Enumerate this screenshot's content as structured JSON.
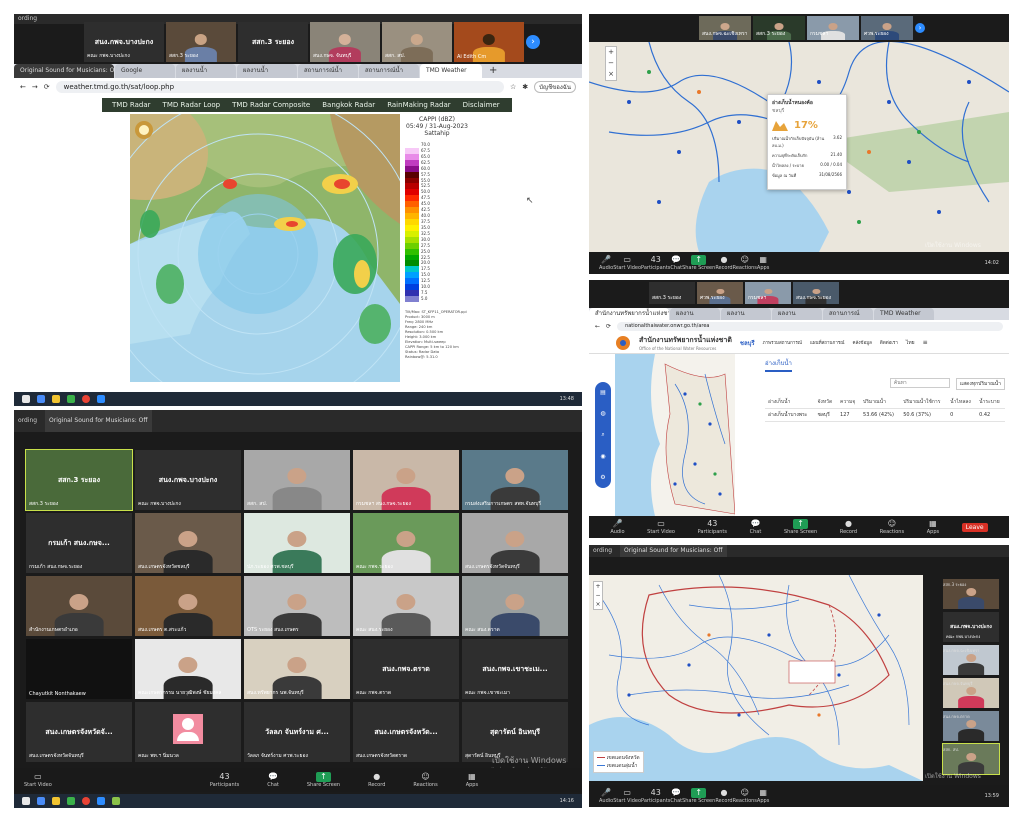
{
  "common": {
    "recording": "ording",
    "original_sound": "Original Sound for Musicians: Off",
    "participants_count": "43",
    "watermark_line1": "เปิดใช้งาน Windows",
    "watermark_line2": "ไปที่ การตั้งค่า เพื่อเปิดใช้งาน Windows",
    "controls": {
      "audio": "Audio",
      "video": "Start Video",
      "participants": "Participants",
      "chat": "Chat",
      "share": "Share Screen",
      "record": "Record",
      "reactions": "Reactions",
      "apps": "Apps",
      "leave": "Leave"
    }
  },
  "panel1": {
    "tiles": [
      {
        "name": "สนง.กพจ.บางปะกง",
        "label": "คณะ กพจ.บางปะกง"
      },
      {
        "name": "",
        "label": "สสก.3 ระยอง"
      },
      {
        "name": "สสก.3 ระยอง",
        "label": ""
      },
      {
        "name": "",
        "label": "สนง.กษจ. จันทบุรี"
      },
      {
        "name": "",
        "label": "สสก. สป."
      },
      {
        "name": "",
        "label": "Ai Edith Cm"
      }
    ],
    "tabs": [
      "Original Sound for Musicians: Off",
      "Google",
      "ผลงานน้ำ",
      "ผลงานน้ำ",
      "สถานการณ์น้ำ",
      "สถานการณ์น้ำ",
      "TMD Weather"
    ],
    "url": "weather.tmd.go.th/sat/loop.php",
    "profile": "บัญชีของฉัน",
    "nav": [
      "TMD Radar",
      "TMD Radar Loop",
      "TMD Radar Composite",
      "Bangkok Radar",
      "RainMaking Radar",
      "Disclaimer"
    ],
    "radar_title": "CAPPI (dBZ)",
    "radar_time": "05:49 / 31-Aug-2023",
    "radar_site": "Sattahip",
    "radar_info": [
      "Tilt/Max: ST_KFP11_OPERATOR.ppi",
      "Product: 3000 m",
      "Freq: 2800 MHz",
      "Range: 240 km",
      "Resolution: 0.500 km",
      "Height: 3.000 km",
      "Elevation: Multi-sweep",
      "CAPPI Range: 5 km to 120 km",
      "Status: Radar Data",
      "Rainbow@: 5.31.0"
    ],
    "legend_labels": [
      "70.0",
      "67.5",
      "65.0",
      "62.5",
      "60.0",
      "57.5",
      "55.0",
      "52.5",
      "50.0",
      "47.5",
      "45.0",
      "42.5",
      "40.0",
      "37.5",
      "35.0",
      "32.5",
      "30.0",
      "27.5",
      "25.0",
      "22.5",
      "20.0",
      "17.5",
      "15.0",
      "12.5",
      "10.0",
      "7.5",
      "5.0"
    ],
    "clock": "13:48"
  },
  "panel2": {
    "tiles": [
      {
        "label": "สนง.กษจ.ฉะเชิงเทรา"
      },
      {
        "label": "สสก.3 ระยอง"
      },
      {
        "label": "กรมชลฯ"
      },
      {
        "label": "ศวพ.ระยอง"
      }
    ],
    "card": {
      "title": "อ่างเก็บน้ำหนองค้อ",
      "subtitle": "ชลบุรี",
      "percent": "17%",
      "rows": [
        {
          "k": "ปริมาณน้ำกักเก็บปัจจุบัน (ล้าน ลบ.ม.)",
          "v": "3.62"
        },
        {
          "k": "ความจุที่ระดับเก็บกัก",
          "v": "21.40"
        },
        {
          "k": "น้ำไหลลง / ระบาย",
          "v": "0.00 / 0.04"
        },
        {
          "k": "ข้อมูล ณ วันที่",
          "v": "31/08/2566"
        }
      ]
    },
    "clock": "14:02"
  },
  "panel3": {
    "tiles": [
      {
        "label": "สสก.3 ระยอง"
      },
      {
        "label": "ศวพ.ระยอง"
      },
      {
        "label": "กรมชลฯ"
      },
      {
        "label": "สนง.กษจ.ระยอง"
      }
    ],
    "url": "nationalthaiwater.onwr.go.th/area",
    "tabs": [
      "สำนักงานทรัพยากรน้ำแห่งชาติ",
      "ผลงาน",
      "ผลงาน",
      "ผลงาน",
      "สถานการณ์",
      "TMD Weather"
    ],
    "org_name": "สำนักงานทรัพยากรน้ำแห่งชาติ",
    "org_sub": "Office of the National Water Resources",
    "province": "ชลบุรี",
    "menu": [
      "ภาพรวมสถานการณ์",
      "แผนที่สถานการณ์",
      "คลังข้อมูล",
      "ติดต่อเรา"
    ],
    "lang": "ไทย",
    "tab_label": "อ่างเก็บน้ำ",
    "search_placeholder": "ค้นหา",
    "filter": "แสดงทุกปริมาณน้ำ",
    "headers": [
      "อ่างเก็บน้ำ",
      "จังหวัด",
      "ความจุ",
      "ปริมาณน้ำ",
      "ปริมาณน้ำใช้การ",
      "น้ำไหลลง",
      "น้ำระบาย"
    ],
    "row": [
      "อ่างเก็บน้ำบางพระ",
      "ชลบุรี",
      "127",
      "53.66 (42%)",
      "50.6 (37%)",
      "0",
      "0.42"
    ],
    "clock": "13:54"
  },
  "panel4": {
    "tiles": [
      {
        "name": "สสก.3 ระยอง",
        "label": "สสก.3 ระยอง"
      },
      {
        "name": "สนง.กพจ.บางปะกง",
        "label": "คณะ กพจ.บางปะกง"
      },
      {
        "name": "",
        "label": "สสก. สป."
      },
      {
        "name": "",
        "label": "กรมชลฯ สนง.กษจ.ระยอง"
      },
      {
        "name": "",
        "label": "กรมส่งเสริมการเกษตร สพท.จันทบุรี"
      },
      {
        "name": "กรมเก้า สนง.กษจ...",
        "label": "กรมเก้า สนง.กษจ.ระยอง"
      },
      {
        "name": "",
        "label": "สนง.เกษตรจังหวัดชลบุรี"
      },
      {
        "name": "",
        "label": "ปภ.ระยอง ศวพ.ชลบุรี"
      },
      {
        "name": "",
        "label": "คณะ กพจ.ระยอง"
      },
      {
        "name": "",
        "label": "สนง.เกษตรจังหวัดจันทบุรี"
      },
      {
        "name": "",
        "label": "สำนักงานเกษตรอำเภอ"
      },
      {
        "name": "",
        "label": "สนง.เกษตร ต.สระแก้ว"
      },
      {
        "name": "",
        "label": "OTS ระยอง สนง.เกษตร"
      },
      {
        "name": "",
        "label": "คณะ สนง.ระยอง"
      },
      {
        "name": "",
        "label": "คณะ สนง.ตราด"
      },
      {
        "name": "",
        "label": "Chayutkit Nonthakaew"
      },
      {
        "name": "",
        "label": "คณะเกษตรกรรม นายวุฒิพงษ์ ชัยมงคล"
      },
      {
        "name": "",
        "label": "สนง.ทรัพยากร นพ.จันทบุรี"
      },
      {
        "name": "สนง.กพจ.ตราด",
        "label": "คณะ กพจ.ตราด"
      },
      {
        "name": "สนง.กพจ.เขาชะเม...",
        "label": "คณะ กพจ.เขาชะเมา"
      },
      {
        "name": "สนง.เกษตรจังหวัดจั...",
        "label": "สนง.เกษตรจังหวัดจันทบุรี"
      },
      {
        "name": "",
        "label": "คณะ พท.ฯ นิ่มนวล"
      },
      {
        "name": "วัลลภ จันทร์งาม ศ...",
        "label": "วัลลภ จันทร์งาม ศวพ.ระยอง"
      },
      {
        "name": "สนง.เกษตรจังหวัด...",
        "label": "สนง.เกษตรจังหวัดตราด"
      },
      {
        "name": "สุดารัตน์ อินทบุรี",
        "label": "สุดารัตน์ อินทบุรี"
      }
    ],
    "clock": "14:16"
  },
  "panel5": {
    "tiles": [
      {
        "name": "",
        "label": "สสก.3 ระยอง"
      },
      {
        "name": "สนง.กพจ.บางปะกง",
        "label": "คณะ กพจ.บางปะกง"
      },
      {
        "name": "",
        "label": "สนง.กษจ.ฉะเชิงเทรา"
      },
      {
        "name": "",
        "label": "สนง.กษจ.จันทบุรี"
      },
      {
        "name": "",
        "label": "สนง.กษจ.ตราด"
      },
      {
        "name": "",
        "label": "สสก. สป."
      }
    ],
    "legend": [
      "เขตแดนจังหวัด",
      "เขตแดนลุ่มน้ำ"
    ],
    "clock": "13:59"
  }
}
